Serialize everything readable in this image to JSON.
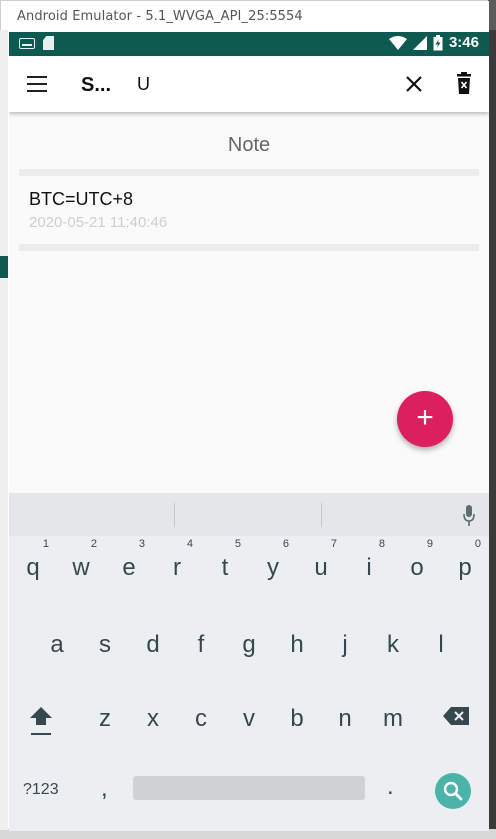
{
  "window": {
    "title": "Android Emulator - 5.1_WVGA_API_25:5554"
  },
  "status_bar": {
    "time": "3:46",
    "bg_color": "#0d5b50"
  },
  "app_bar": {
    "title": "S...",
    "search_value": "U"
  },
  "content": {
    "section_header": "Note",
    "notes": [
      {
        "title": "BTC=UTC+8",
        "timestamp": "2020-05-21 11:40:46"
      }
    ]
  },
  "fab": {
    "label": "+",
    "color": "#dc1f5e"
  },
  "keyboard": {
    "row1": [
      {
        "key": "q",
        "hint": "1"
      },
      {
        "key": "w",
        "hint": "2"
      },
      {
        "key": "e",
        "hint": "3"
      },
      {
        "key": "r",
        "hint": "4"
      },
      {
        "key": "t",
        "hint": "5"
      },
      {
        "key": "y",
        "hint": "6"
      },
      {
        "key": "u",
        "hint": "7"
      },
      {
        "key": "i",
        "hint": "8"
      },
      {
        "key": "o",
        "hint": "9"
      },
      {
        "key": "p",
        "hint": "0"
      }
    ],
    "row2": [
      "a",
      "s",
      "d",
      "f",
      "g",
      "h",
      "j",
      "k",
      "l"
    ],
    "row3": [
      "z",
      "x",
      "c",
      "v",
      "b",
      "n",
      "m"
    ],
    "symbols_label": "?123",
    "comma_label": ",",
    "period_label": ".",
    "search_key_color": "#4bb3a8"
  }
}
